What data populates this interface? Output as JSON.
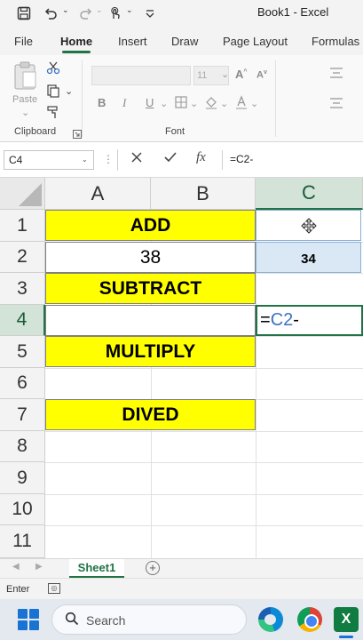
{
  "titlebar": {
    "title": "Book1  -  Excel",
    "caret": "⌄"
  },
  "tabs": [
    {
      "label": "File"
    },
    {
      "label": "Home"
    },
    {
      "label": "Insert"
    },
    {
      "label": "Draw"
    },
    {
      "label": "Page Layout"
    },
    {
      "label": "Formulas"
    }
  ],
  "ribbon": {
    "paste_label": "Paste",
    "clipboard_label": "Clipboard",
    "font_label": "Font",
    "font_size": "11",
    "bold": "B",
    "italic": "I",
    "underline": "U"
  },
  "formula_bar": {
    "name_box": "C4",
    "formula": "=C2-",
    "fx_label": "fx"
  },
  "columns": [
    "A",
    "B",
    "C"
  ],
  "rows": [
    "1",
    "2",
    "3",
    "4",
    "5",
    "6",
    "7",
    "8",
    "9",
    "10",
    "11"
  ],
  "cells": {
    "a1": "ADD",
    "a2": "38",
    "a3": "SUBTRACT",
    "a5": "MULTIPLY",
    "a7": "DIVED",
    "c2": "34",
    "c4_prefix": "=",
    "c4_ref": "C2",
    "c4_suffix": "-"
  },
  "sheets": [
    {
      "label": "Sheet1"
    }
  ],
  "add_sheet": "+",
  "status": {
    "mode": "Enter"
  },
  "taskbar": {
    "search_placeholder": "Search",
    "excel_label": "X"
  },
  "colors": {
    "accent": "#217346",
    "highlight": "#ffff00",
    "reference": "#3a72c4",
    "selection": "#dae7f5"
  }
}
